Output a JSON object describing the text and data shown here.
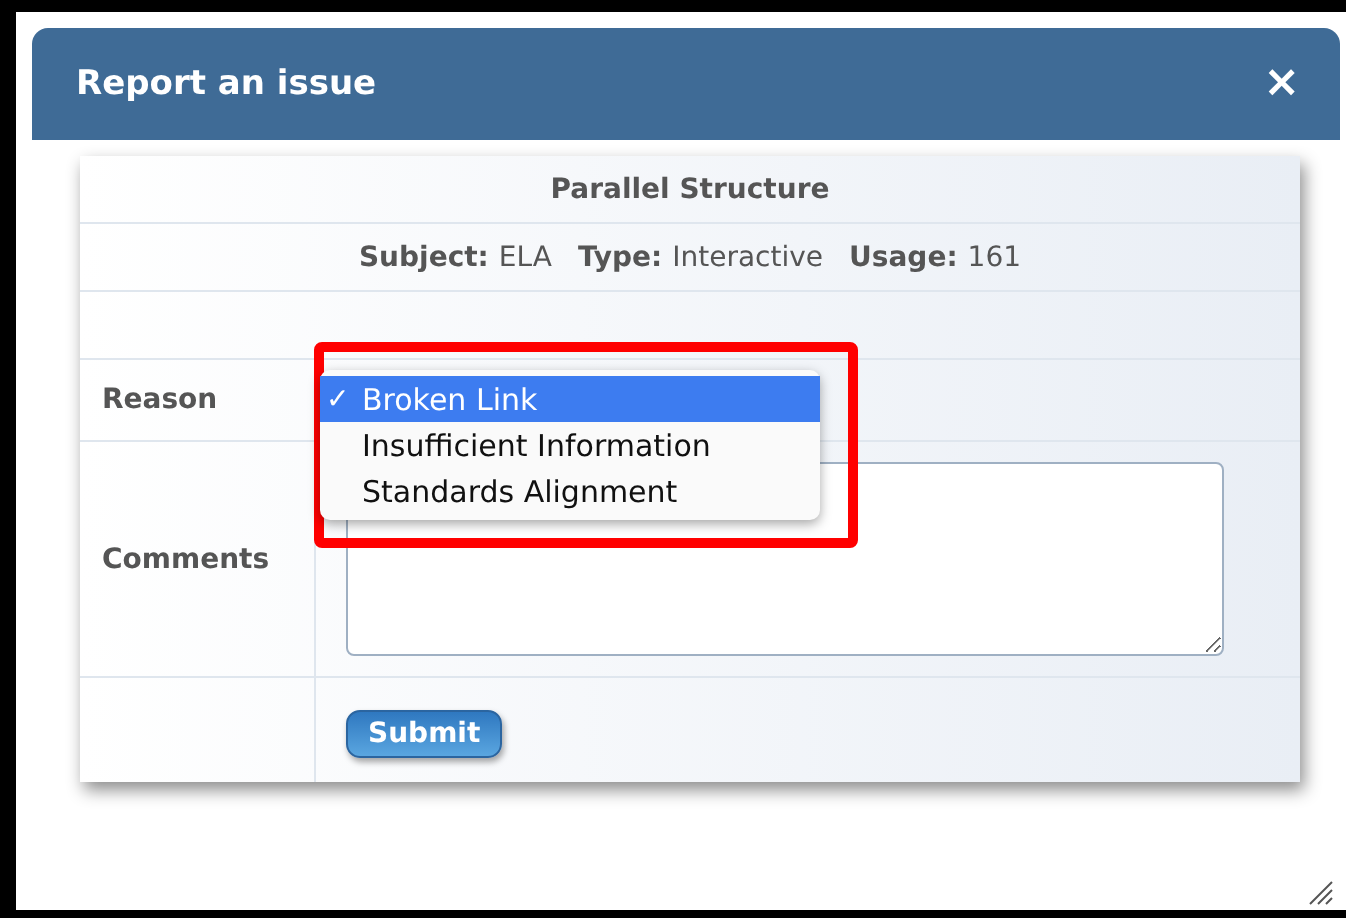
{
  "dialog": {
    "title": "Report an issue",
    "close_icon": "×"
  },
  "resource": {
    "title": "Parallel Structure",
    "meta": [
      {
        "label": "Subject:",
        "value": "ELA"
      },
      {
        "label": "Type:",
        "value": "Interactive"
      },
      {
        "label": "Usage:",
        "value": "161"
      }
    ]
  },
  "form": {
    "reason_label": "Reason",
    "reason_options": [
      {
        "label": "Broken Link",
        "selected": true
      },
      {
        "label": "Insufficient Information",
        "selected": false
      },
      {
        "label": "Standards Alignment",
        "selected": false
      }
    ],
    "check_mark": "✓",
    "comments_label": "Comments",
    "submit": "Submit"
  }
}
